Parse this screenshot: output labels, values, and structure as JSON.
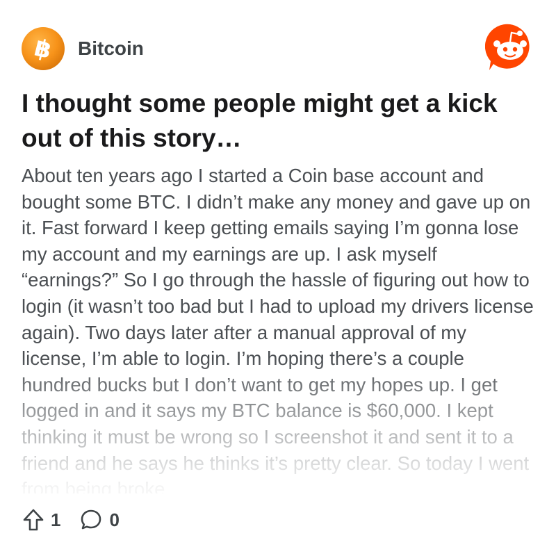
{
  "header": {
    "subreddit_name": "Bitcoin",
    "subreddit_icon": "bitcoin-icon",
    "app_icon": "reddit-logo-icon",
    "colors": {
      "bitcoin_orange": "#f7931a",
      "reddit_orange": "#ff4500"
    }
  },
  "post": {
    "title": "I thought some people might get a kick out of this story…",
    "body": "About ten years ago I started a Coin base account and bought some BTC. I didn’t make any money and gave up on it. Fast forward I keep getting emails saying I’m gonna lose my account and my earnings are up. I ask myself “earnings?” So I go through the hassle of figuring out how to login (it wasn’t too bad but I had to upload my drivers license again). Two days later after a manual approval of my license, I’m able to login. I’m hoping there’s a couple hundred bucks but I don’t want to get my hopes up. I get logged in and it says my BTC balance is $60,000. I kept thinking it must be wrong so I screenshot it and sent it to a friend and he says he thinks it’s pretty clear. So today I went from being broke"
  },
  "footer": {
    "upvote_icon": "upvote-arrow-icon",
    "upvotes": "1",
    "comment_icon": "comment-bubble-icon",
    "comments": "0"
  }
}
